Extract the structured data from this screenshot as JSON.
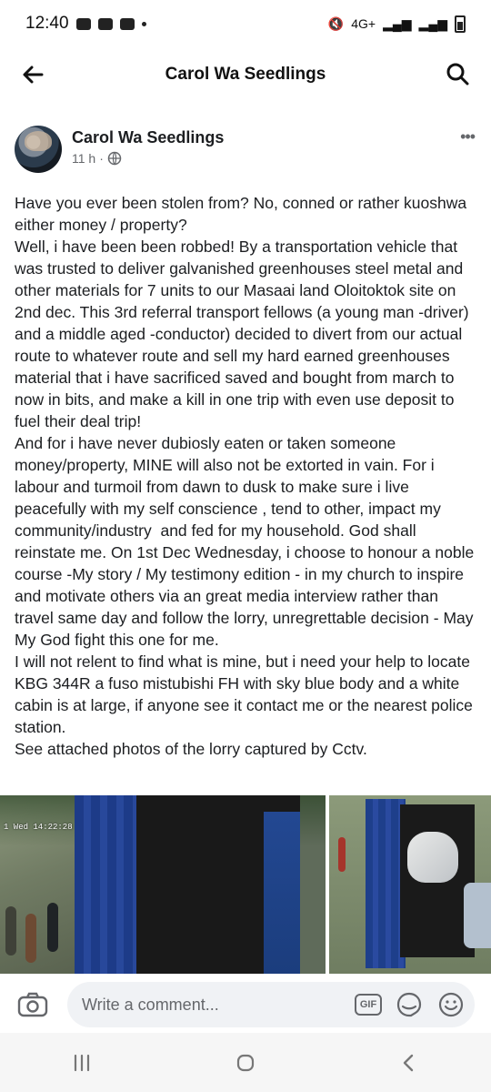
{
  "status_bar": {
    "time": "12:40",
    "network": "4G+"
  },
  "header": {
    "title": "Carol Wa Seedlings"
  },
  "post": {
    "author": "Carol Wa Seedlings",
    "time": "11 h",
    "separator": "·",
    "more": "•••",
    "text": "Have you ever been stolen from? No, conned or rather kuoshwa either money / property?\nWell, i have been been robbed! By a transportation vehicle that was trusted to deliver galvanished greenhouses steel metal and other materials for 7 units to our Masaai land Oloitoktok site on 2nd dec. This 3rd referral transport fellows (a young man -driver) and a middle aged -conductor) decided to divert from our actual route to whatever route and sell my hard earned greenhouses material that i have sacrificed saved and bought from march to now in bits, and make a kill in one trip with even use deposit to fuel their deal trip!\nAnd for i have never dubiosly eaten or taken someone money/property, MINE will also not be extorted in vain. For i labour and turmoil from dawn to dusk to make sure i live peacefully with my self conscience , tend to other, impact my community/industry  and fed for my household. God shall reinstate me. On 1st Dec Wednesday, i choose to honour a noble course -My story / My testimony edition - in my church to inspire and motivate others via an great media interview rather than travel same day and follow the lorry, unregrettable decision - May My God fight this one for me.\nI will not relent to find what is mine, but i need your help to locate KBG 344R a fuso mistubishi FH with sky blue body and a white cabin is at large, if anyone see it contact me or the nearest police station.\nSee attached photos of the lorry captured by Cctv.",
    "photo_timestamp": "1 Wed 14:22:28"
  },
  "comment": {
    "placeholder": "Write a comment...",
    "gif": "GIF"
  }
}
